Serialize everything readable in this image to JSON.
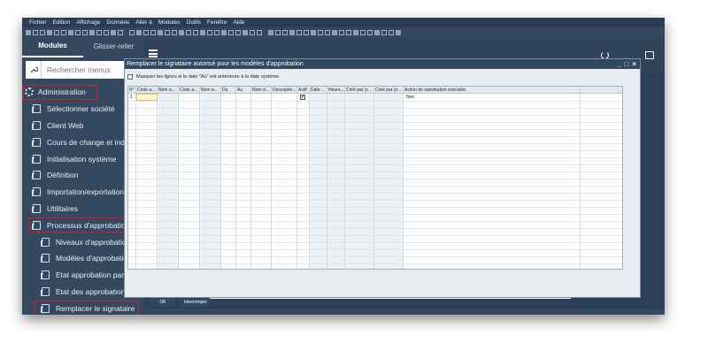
{
  "menubar": [
    "Fichier",
    "Edition",
    "Affichage",
    "Données",
    "Aller à",
    "Modules",
    "Outils",
    "Fenêtre",
    "Aide"
  ],
  "sidebar": {
    "tabs": [
      "Modules",
      "Glisser-relier"
    ],
    "search": {
      "placeholder": "Rechercher menus"
    },
    "items": [
      {
        "label": "Administration",
        "level": 0,
        "highlighted": true
      },
      {
        "label": "Sélectionner société",
        "level": 1
      },
      {
        "label": "Client Web",
        "level": 1
      },
      {
        "label": "Cours de change et index",
        "level": 1
      },
      {
        "label": "Initialisation système",
        "level": 1
      },
      {
        "label": "Définition",
        "level": 1
      },
      {
        "label": "Importation/exportation do",
        "level": 1
      },
      {
        "label": "Utilitaires",
        "level": 1
      },
      {
        "label": "Processus d'approbation",
        "level": 1,
        "highlighted": true
      },
      {
        "label": "Niveaux d'approbation",
        "level": 2
      },
      {
        "label": "Modèles d'approbation",
        "level": 2
      },
      {
        "label": "Etat approbation par sta",
        "level": 2
      },
      {
        "label": "Etat des approbations",
        "level": 2
      },
      {
        "label": "Remplacer le signataire",
        "level": 2,
        "highlighted": true
      }
    ]
  },
  "dialog": {
    "title": "Remplacer le signataire autorisé pour les modèles d'approbation",
    "controls": [
      "_",
      "□",
      "×"
    ],
    "checkbox_label": "Masquer les lignes si la date \"Au\" est antérieure à la date système",
    "grid": {
      "columns": [
        "N°",
        "Code a...",
        "Nom a...",
        "Code a...",
        "Nom a...",
        "Du",
        "Au",
        "Nom d...",
        "Descriptio...",
        "Actif",
        "Date ...",
        "Heure...",
        "Créé par (c...",
        "Créé par (n...",
        "Action de substitution exécutée"
      ],
      "rows": [
        {
          "no": "1",
          "active": "✔",
          "action": "Non"
        }
      ]
    },
    "buttons": {
      "ok": "OK",
      "cancel": "Interrompre"
    }
  },
  "colors": {
    "highlight_border": "#d11f2a",
    "sidebar_bg": "#34495f",
    "title_bar": "#32485f"
  }
}
